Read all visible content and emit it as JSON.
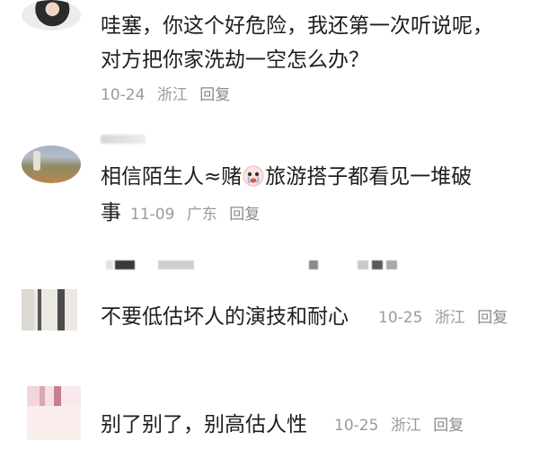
{
  "comments": [
    {
      "text_lines": [
        "哇塞，你这个好危险，我还第一次听说呢，",
        "对方把你家洗劫一空怎么办？"
      ],
      "date": "10-24",
      "location": "浙江",
      "reply": "回复"
    },
    {
      "username": "...",
      "text_before_emoji": "相信陌生人≈赌",
      "emoji": "crying-face-icon",
      "text_after_emoji": "旅游搭子都看见一堆破",
      "text_line2": "事",
      "date": "11-09",
      "location": "广东",
      "reply": "回复"
    },
    {
      "text": "不要低估坏人的演技和耐心",
      "date": "10-25",
      "location": "浙江",
      "reply": "回复"
    },
    {
      "text": "别了别了，别高估人性",
      "date": "10-25",
      "location": "浙江",
      "reply": "回复"
    }
  ]
}
